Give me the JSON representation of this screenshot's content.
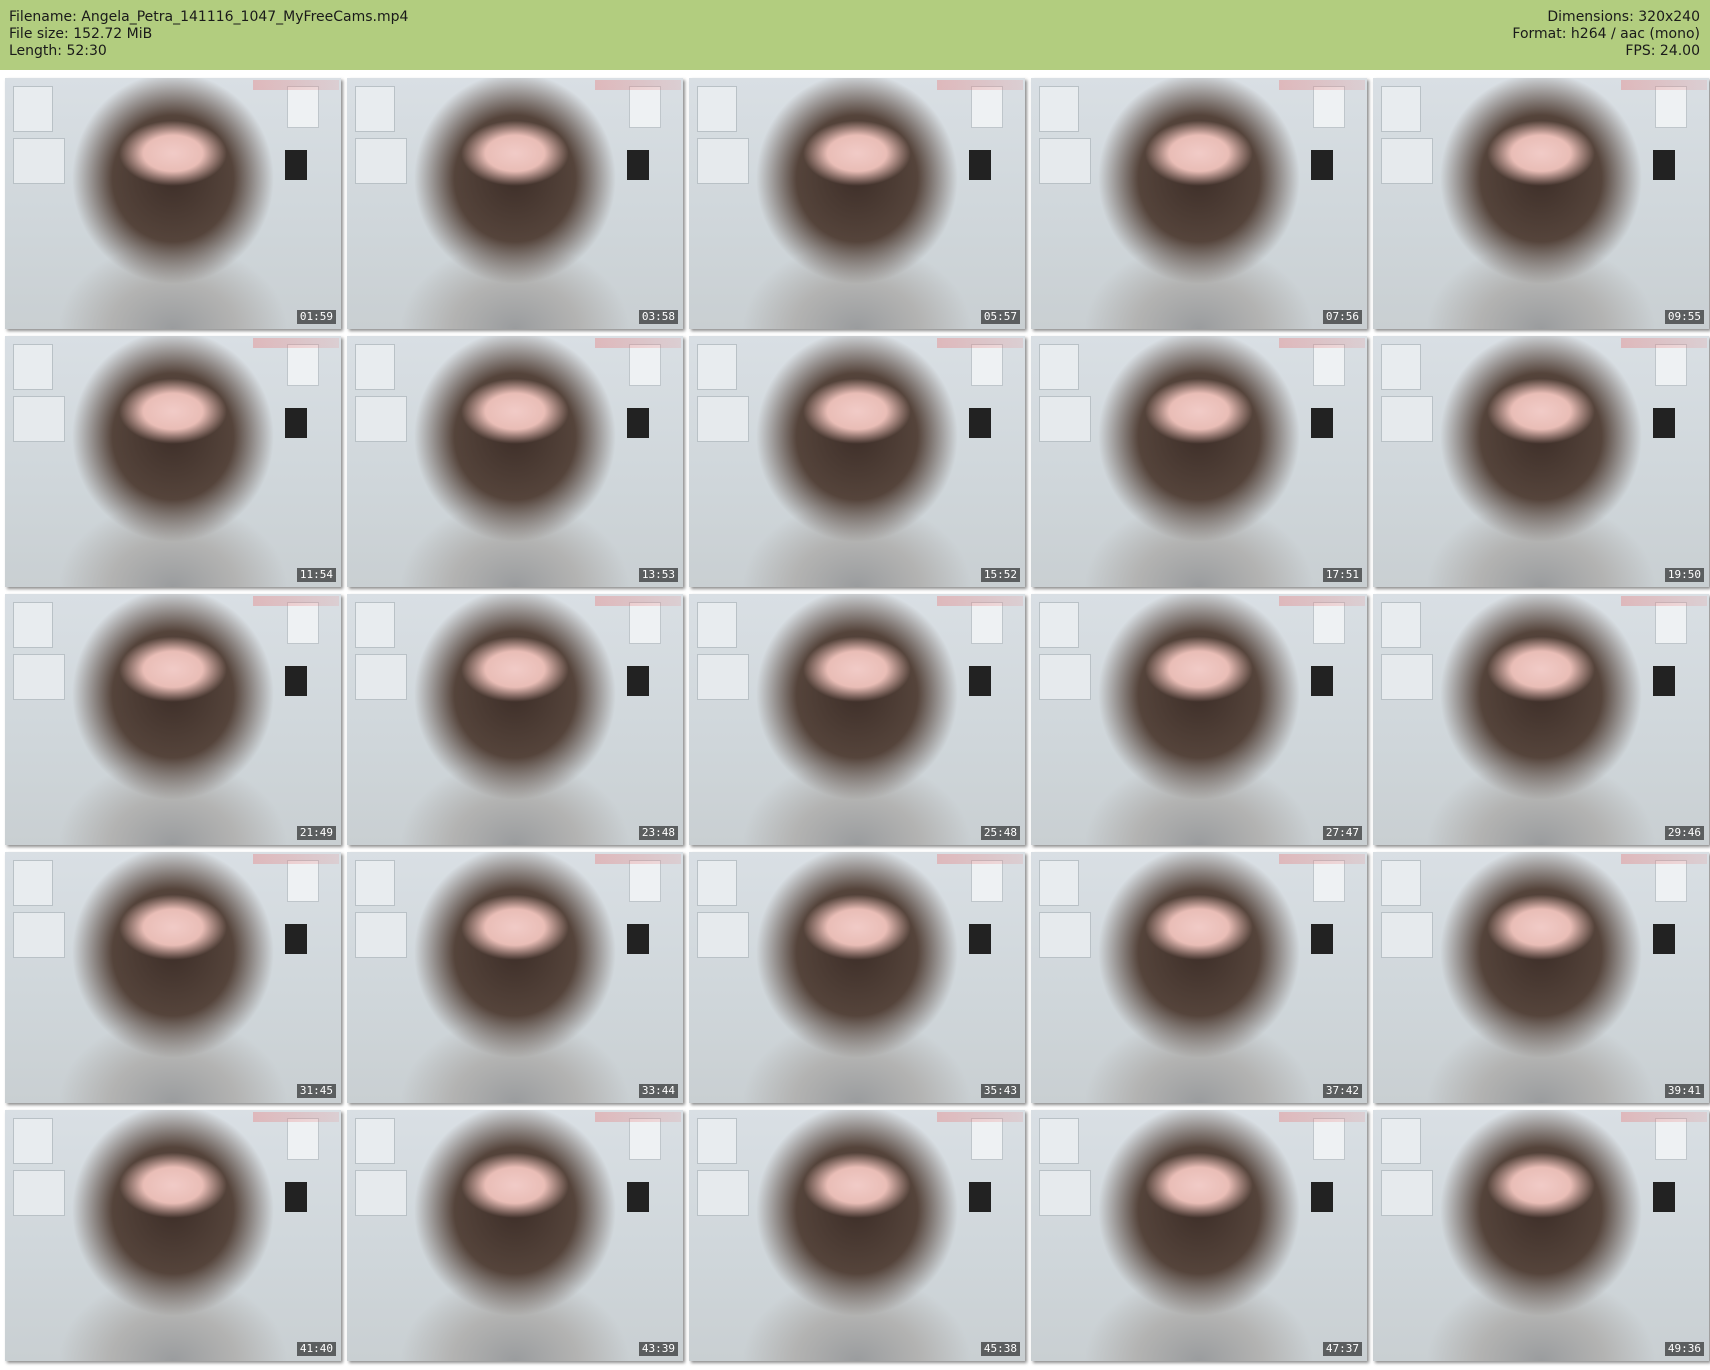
{
  "meta": {
    "left": [
      "Filename: Angela_Petra_141116_1047_MyFreeCams.mp4",
      "File size: 152.72 MiB",
      "Length: 52:30"
    ],
    "right": [
      "Dimensions: 320x240",
      "Format: h264 / aac (mono)",
      "FPS: 24.00"
    ]
  },
  "thumbnails": [
    {
      "time": "01:59"
    },
    {
      "time": "03:58"
    },
    {
      "time": "05:57"
    },
    {
      "time": "07:56"
    },
    {
      "time": "09:55"
    },
    {
      "time": "11:54"
    },
    {
      "time": "13:53"
    },
    {
      "time": "15:52"
    },
    {
      "time": "17:51"
    },
    {
      "time": "19:50"
    },
    {
      "time": "21:49"
    },
    {
      "time": "23:48"
    },
    {
      "time": "25:48"
    },
    {
      "time": "27:47"
    },
    {
      "time": "29:46"
    },
    {
      "time": "31:45"
    },
    {
      "time": "33:44"
    },
    {
      "time": "35:43"
    },
    {
      "time": "37:42"
    },
    {
      "time": "39:41"
    },
    {
      "time": "41:40"
    },
    {
      "time": "43:39"
    },
    {
      "time": "45:38"
    },
    {
      "time": "47:37"
    },
    {
      "time": "49:36"
    }
  ]
}
